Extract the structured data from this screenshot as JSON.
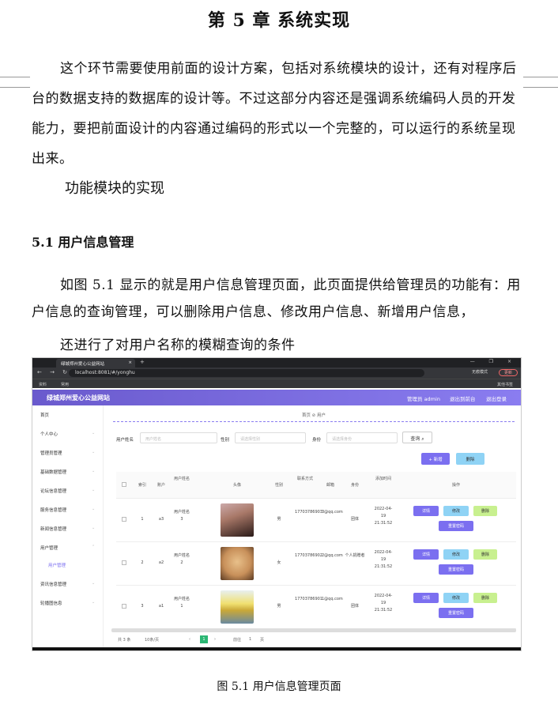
{
  "doc": {
    "chapter_title": "第 5 章  系统实现",
    "para1": "这个环节需要使用前面的设计方案，包括对系统模块的设计，还有对程序后台的数据支持的数据库的设计等。不过这部分内容还是强调系统编码人员的开发能力，要把前面设计的内容通过编码的形式以一个完整的，可以运行的系统呈现出来。",
    "subheading": "功能模块的实现",
    "section_heading": "5.1 用户信息管理",
    "para2": "如图 5.1 显示的就是用户信息管理页面，此页面提供给管理员的功能有：用户信息的查询管理，可以删除用户信息、修改用户信息、新增用户信息，",
    "para3": "还进行了对用户名称的模糊查询的条件",
    "caption": "图 5.1 用户信息管理页面"
  },
  "browser": {
    "tab_title": "绿城郑州爱心公益网站",
    "url": "localhost:8081/#/yonghu",
    "incognito_label": "无痕模式",
    "update_label": "更新",
    "bookmarks": [
      "资料",
      "常用"
    ],
    "bookmarks_right": "其他书签"
  },
  "app": {
    "title": "绿城郑州爱心公益网站",
    "admin_label": "管理员 admin",
    "back_label": "退出到前台",
    "logout_label": "退出登录",
    "sidebar": [
      "首页",
      "个人中心",
      "管理员管理",
      "基础数据管理",
      "论坛信息管理",
      "服务信息管理",
      "新闻信息管理",
      "用户管理",
      "用户管理",
      "资讯信息管理",
      "轮播图信息"
    ],
    "breadcrumb": "首页 ⊘ 用户",
    "filters": {
      "name_label": "用户姓名",
      "name_placeholder": "用户姓名",
      "gender_label": "性别",
      "gender_placeholder": "请选择性别",
      "identity_label": "身份",
      "identity_placeholder": "请选择身份",
      "search_label": "查询"
    },
    "add_label": "+ 新增",
    "delete_label": "删除",
    "headers": [
      "索引",
      "账户",
      "用户姓名",
      "头像",
      "性别",
      "联系方式",
      "邮箱",
      "身份",
      "添加时间",
      "操作"
    ],
    "rows": [
      {
        "index": "1",
        "account": "a3",
        "name": "用户姓名3",
        "gender": "男",
        "phone": "17703786903",
        "email": "3@qq.com",
        "identity": "团体",
        "time": "2022-04-19 21:31:52"
      },
      {
        "index": "2",
        "account": "a2",
        "name": "用户姓名2",
        "gender": "女",
        "phone": "17703786902",
        "email": "2@qq.com",
        "identity": "个人捐赠者",
        "time": "2022-04-19 21:31:52"
      },
      {
        "index": "3",
        "account": "a1",
        "name": "用户姓名1",
        "gender": "男",
        "phone": "17703786901",
        "email": "1@qq.com",
        "identity": "团体",
        "time": "2022-04-19 21:31:52"
      }
    ],
    "ops": {
      "detail": "详情",
      "edit": "修改",
      "delete": "删除",
      "reset": "重置密码"
    },
    "pager": {
      "total": "共 3 条",
      "size": "10条/页",
      "current": "1",
      "goto": "前往",
      "page": "1",
      "unit": "页"
    }
  }
}
